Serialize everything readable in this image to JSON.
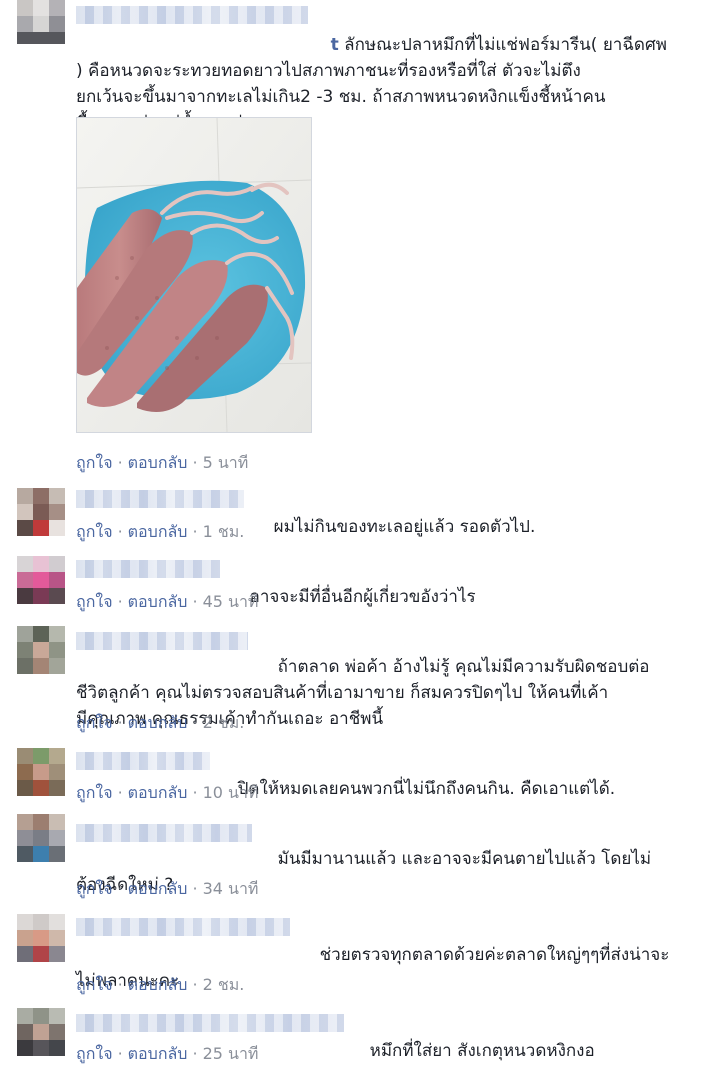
{
  "actions": {
    "like": "ถูกใจ",
    "reply": "ตอบกลับ",
    "dot": "·"
  },
  "comments": [
    {
      "name_tail": "t",
      "text": "ลักษณะปลาหมึกที่ไม่แช่ฟอร์มารีน( ยาฉีดศพ\n) คือหนวดจะระทวยทอดยาวไปสภาพภาชนะที่รองหรือที่ใส่ ตัวจะไม่ตึง\nยกเว้นจะขึ้นมาจากทะเลไม่เกิน2 -3 ชม. ถ้าสภาพหนวดหงิกแข็งชี้หน้าคน\nซื้อแสดงว่าแช่น้ำยาแน่นอน",
      "time": "5 นาที"
    },
    {
      "text": "ผมไม่กินของทะเลอยู่แล้ว รอดตัวไป.",
      "time": "1 ชม."
    },
    {
      "text": "อาจจะมีที่อื่นอีกผู้เกี่ยวขอังว่าไร",
      "time": "45 นาที"
    },
    {
      "text": "ถ้าตลาด พ่อค้า อ้างไม่รู้ คุณไม่มีความรับผิดชอบต่อ\nชีวิตลูกค้า คุณไม่ตรวจสอบสินค้าที่เอามาขาย ก็สมควรปิดๆไป ให้คนที่เค้า\nมีคุณภาพ คุณธรรมเค้าทำกันเถอะ อาชีพนี้",
      "time": "2 ชม."
    },
    {
      "text": "ปิดให้หมดเลยคนพวกนี่ไม่นึกถึงคนกิน. คืดเอาแต่ได้.",
      "time": "10 นาที"
    },
    {
      "text": "มันมีมานานแล้ว และอาจจะมีคนตายไปแล้ว โดยไม่\nต้องฉีดใหม่ ?",
      "time": "34 นาที"
    },
    {
      "text": "ช่วยตรวจทุกตลาดด้วยค่ะตลาดใหญ่ๆๆที่ส่งน่าจะ\nไม่พลาดนะคะ",
      "time": "2 ชม."
    },
    {
      "text": "หมึกที่ใส่ยา สังเกตุหนวดหงิกงอ",
      "time": "25 นาที"
    }
  ],
  "colors": {
    "link": "#4b67a1",
    "meta": "#8a8f99",
    "text": "#1d2129",
    "plate": "#4fb5d6"
  }
}
